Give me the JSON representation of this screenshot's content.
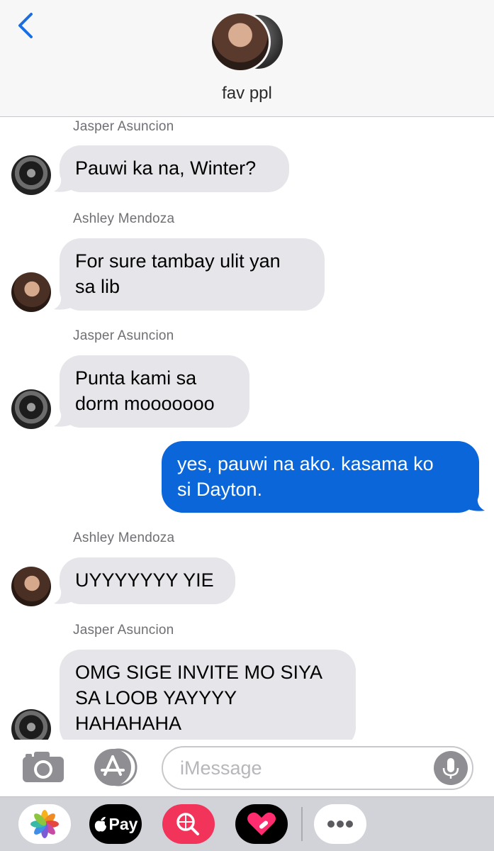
{
  "header": {
    "back_icon": "chevron-left-icon",
    "group_name": "fav ppl",
    "accent_color": "#1a6fe0"
  },
  "messages": [
    {
      "sender": "Jasper Asuncion",
      "direction": "incoming",
      "text_lines": [
        "Pauwi ka na, Winter?"
      ]
    },
    {
      "sender": "Ashley Mendoza",
      "direction": "incoming",
      "text_lines": [
        "For sure tambay ulit yan",
        "sa lib"
      ]
    },
    {
      "sender": "Jasper Asuncion",
      "direction": "incoming",
      "text_lines": [
        "Punta kami sa",
        "dorm mooooooo"
      ]
    },
    {
      "sender": "",
      "direction": "outgoing",
      "text_lines": [
        "yes, pauwi na ako. kasama ko",
        "si Dayton."
      ]
    },
    {
      "sender": "Ashley Mendoza",
      "direction": "incoming",
      "text_lines": [
        "UYYYYYYY YIE"
      ]
    },
    {
      "sender": "Jasper Asuncion",
      "direction": "incoming",
      "text_lines": [
        "OMG SIGE INVITE MO SIYA",
        "SA LOOB YAYYYY",
        "HAHAHAHA"
      ]
    }
  ],
  "colors": {
    "incoming_bubble": "#e5e5ea",
    "outgoing_bubble": "#0b66d9"
  },
  "input": {
    "placeholder": "iMessage",
    "camera_icon": "camera-icon",
    "apps_icon": "app-store-icon",
    "mic_icon": "microphone-icon"
  },
  "app_drawer": {
    "apps": [
      {
        "icon": "photos-icon"
      },
      {
        "icon": "apple-pay-icon",
        "label": "Pay"
      },
      {
        "icon": "image-search-icon"
      },
      {
        "icon": "digital-touch-icon"
      },
      {
        "icon": "more-icon"
      }
    ]
  }
}
